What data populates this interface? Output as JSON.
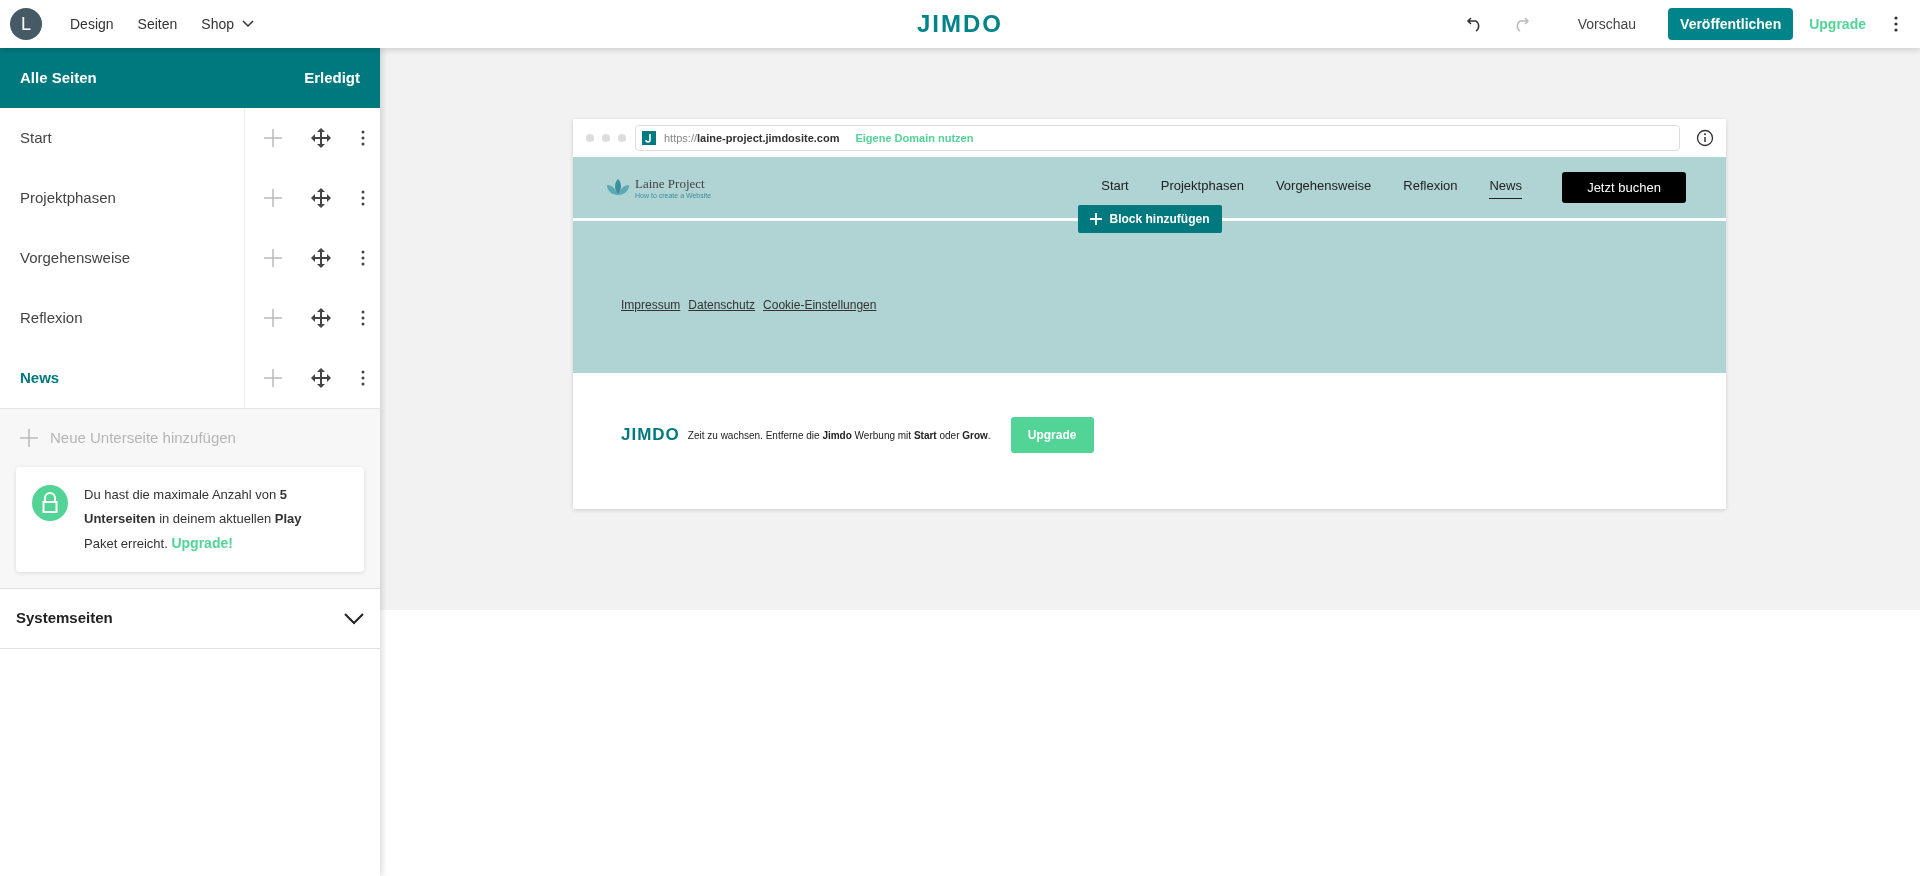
{
  "topbar": {
    "avatar": "L",
    "menu": [
      {
        "label": "Design",
        "dropdown": false
      },
      {
        "label": "Seiten",
        "dropdown": false
      },
      {
        "label": "Shop",
        "dropdown": true
      }
    ],
    "logo": "JIMDO",
    "preview": "Vorschau",
    "publish": "Veröffentlichen",
    "upgrade": "Upgrade"
  },
  "sidebar": {
    "title": "Alle Seiten",
    "done": "Erledigt",
    "pages": [
      {
        "label": "Start",
        "selected": false
      },
      {
        "label": "Projektphasen",
        "selected": false
      },
      {
        "label": "Vorgehensweise",
        "selected": false
      },
      {
        "label": "Reflexion",
        "selected": false
      },
      {
        "label": "News",
        "selected": true
      }
    ],
    "add_page": "Neue Unterseite hinzufügen",
    "notice": {
      "text": "Du hast die maximale Anzahl von **5 Unterseiten** in deinem aktuellen **Play** Paket erreicht.",
      "link": "Upgrade!"
    },
    "system_pages": {
      "label": "Systemseiten",
      "expanded": false
    }
  },
  "preview": {
    "url_prefix": "https://",
    "url": "laine-project.jimdosite.com",
    "domain_link": "Eigene Domain nutzen",
    "site_logo": {
      "name": "Laine Project",
      "tagline": "How to create a Website"
    },
    "nav": [
      {
        "label": "Start",
        "selected": false
      },
      {
        "label": "Projektphasen",
        "selected": false
      },
      {
        "label": "Vorgehensweise",
        "selected": false
      },
      {
        "label": "Reflexion",
        "selected": false
      },
      {
        "label": "News",
        "selected": true
      }
    ],
    "cta": "Jetzt buchen",
    "add_block": "Block hinzufügen",
    "footer_links": [
      "Impressum",
      "Datenschutz",
      "Cookie-Einstellungen"
    ],
    "ad": {
      "logo": "JIMDO",
      "text": "Zeit zu wachsen. Entferne die **Jimdo** Werbung mit **Start** oder **Grow**.",
      "button": "Upgrade"
    }
  }
}
